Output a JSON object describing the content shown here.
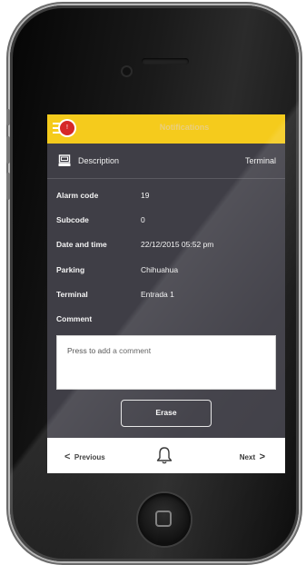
{
  "colors": {
    "accent": "#f5cb1c",
    "screen_bg": "#3f3e46",
    "badge": "#d62828",
    "bottom_bar": "#ffffff"
  },
  "header": {
    "title": "Notifications",
    "badge_count": "!",
    "menu_icon": "hamburger-menu-icon"
  },
  "description_bar": {
    "icon": "terminal-icon",
    "label": "Description",
    "right_label": "Terminal"
  },
  "details": [
    {
      "key": "Alarm code",
      "value": "19"
    },
    {
      "key": "Subcode",
      "value": "0"
    },
    {
      "key": "Date and time",
      "value": "22/12/2015  05:52 pm"
    },
    {
      "key": "Parking",
      "value": "Chihuahua"
    },
    {
      "key": "Terminal",
      "value": "Entrada 1"
    },
    {
      "key": "Comment",
      "value": ""
    }
  ],
  "comment": {
    "placeholder": "Press to add a comment"
  },
  "erase_button": "Erase",
  "navigation": {
    "previous": "Previous",
    "next": "Next",
    "prev_chevron": "<",
    "next_chevron": ">",
    "bell_icon": "bell-icon"
  }
}
